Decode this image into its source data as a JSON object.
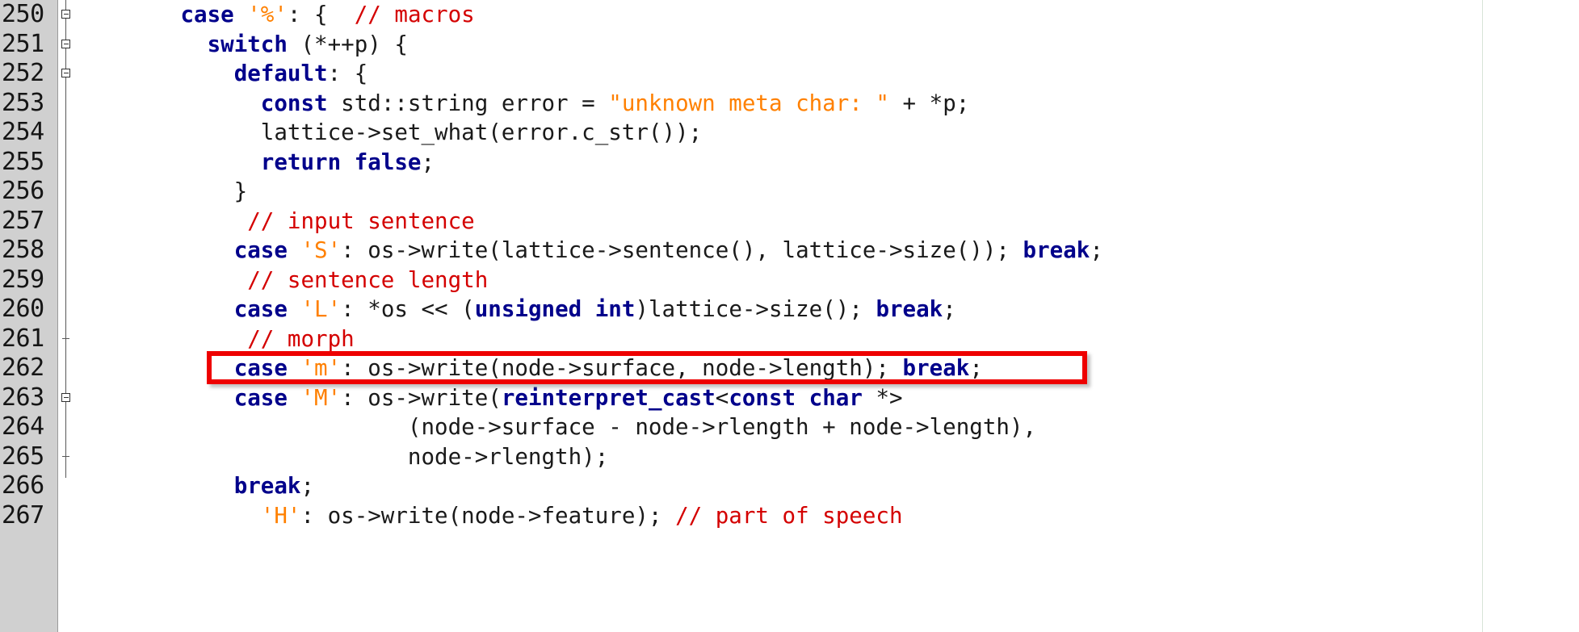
{
  "editor": {
    "language": "C++",
    "colors": {
      "background": "#ffffff",
      "gutter_background": "#d0d0d0",
      "keyword": "#00008b",
      "string": "#ff8000",
      "comment": "#d40000",
      "plain": "#1a1a1a",
      "highlight_box": "#ee0000",
      "guide_line": "#d8e4d8"
    },
    "first_visible_line": 250,
    "last_visible_line": 267
  },
  "gutter": {
    "line_numbers": [
      "250",
      "251",
      "252",
      "253",
      "254",
      "255",
      "256",
      "257",
      "258",
      "259",
      "260",
      "261",
      "262",
      "263",
      "264",
      "265",
      "266",
      "267"
    ]
  },
  "fold_markers": [
    {
      "line": "250",
      "type": "fold-box"
    },
    {
      "line": "251",
      "type": "fold-box"
    },
    {
      "line": "252",
      "type": "fold-box"
    },
    {
      "line": "261",
      "type": "fold-tick"
    },
    {
      "line": "263",
      "type": "fold-box"
    },
    {
      "line": "265",
      "type": "fold-tick"
    }
  ],
  "highlight": {
    "line": "260",
    "color": "#ee0000",
    "label": "red-annotation-box"
  },
  "code_lines": [
    {
      "number": "250",
      "text": "        case '%': {  // macros",
      "tokens": [
        {
          "t": "        ",
          "c": "pln"
        },
        {
          "t": "case",
          "c": "kw"
        },
        {
          "t": " ",
          "c": "pln"
        },
        {
          "t": "'%'",
          "c": "chr"
        },
        {
          "t": ": {  ",
          "c": "pln"
        },
        {
          "t": "// macros",
          "c": "cmt"
        }
      ]
    },
    {
      "number": "251",
      "text": "          switch (*++p) {",
      "tokens": [
        {
          "t": "          ",
          "c": "pln"
        },
        {
          "t": "switch",
          "c": "kw"
        },
        {
          "t": " (*++p) {",
          "c": "pln"
        }
      ]
    },
    {
      "number": "252",
      "text": "            default: {",
      "tokens": [
        {
          "t": "            ",
          "c": "pln"
        },
        {
          "t": "default",
          "c": "kw"
        },
        {
          "t": ": {",
          "c": "pln"
        }
      ]
    },
    {
      "number": "253",
      "text": "              const std::string error = \"unknown meta char: \" + *p;",
      "tokens": [
        {
          "t": "              ",
          "c": "pln"
        },
        {
          "t": "const",
          "c": "kw"
        },
        {
          "t": " std::string error = ",
          "c": "pln"
        },
        {
          "t": "\"unknown meta char: \"",
          "c": "str"
        },
        {
          "t": " + *p;",
          "c": "pln"
        }
      ]
    },
    {
      "number": "254",
      "text": "              lattice->set_what(error.c_str());",
      "tokens": [
        {
          "t": "              lattice->set_what(error.c_str());",
          "c": "pln"
        }
      ]
    },
    {
      "number": "255",
      "text": "              return false;",
      "tokens": [
        {
          "t": "              ",
          "c": "pln"
        },
        {
          "t": "return",
          "c": "kw"
        },
        {
          "t": " ",
          "c": "pln"
        },
        {
          "t": "false",
          "c": "kw"
        },
        {
          "t": ";",
          "c": "pln"
        }
      ]
    },
    {
      "number": "256",
      "text": "            }",
      "tokens": [
        {
          "t": "            }",
          "c": "pln"
        }
      ]
    },
    {
      "number": "257",
      "text": "             // input sentence",
      "tokens": [
        {
          "t": "             ",
          "c": "pln"
        },
        {
          "t": "// input sentence",
          "c": "cmt"
        }
      ]
    },
    {
      "number": "258",
      "text": "            case 'S': os->write(lattice->sentence(), lattice->size()); break;",
      "tokens": [
        {
          "t": "            ",
          "c": "pln"
        },
        {
          "t": "case",
          "c": "kw"
        },
        {
          "t": " ",
          "c": "pln"
        },
        {
          "t": "'S'",
          "c": "chr"
        },
        {
          "t": ": os->write(lattice->sentence(), lattice->size()); ",
          "c": "pln"
        },
        {
          "t": "break",
          "c": "kw"
        },
        {
          "t": ";",
          "c": "pln"
        }
      ]
    },
    {
      "number": "259",
      "text": "             // sentence length",
      "tokens": [
        {
          "t": "             ",
          "c": "pln"
        },
        {
          "t": "// sentence length",
          "c": "cmt"
        }
      ]
    },
    {
      "number": "260",
      "text": "            case 'L': *os << (unsigned int)lattice->size(); break;",
      "tokens": [
        {
          "t": "            ",
          "c": "pln"
        },
        {
          "t": "case",
          "c": "kw"
        },
        {
          "t": " ",
          "c": "pln"
        },
        {
          "t": "'L'",
          "c": "chr"
        },
        {
          "t": ": *os << (",
          "c": "pln"
        },
        {
          "t": "unsigned int",
          "c": "kw"
        },
        {
          "t": ")lattice->size(); ",
          "c": "pln"
        },
        {
          "t": "break",
          "c": "kw"
        },
        {
          "t": ";",
          "c": "pln"
        }
      ]
    },
    {
      "number": "261",
      "text": "             // morph",
      "tokens": [
        {
          "t": "             ",
          "c": "pln"
        },
        {
          "t": "// morph",
          "c": "cmt"
        }
      ]
    },
    {
      "number": "262",
      "text": "            case 'm': os->write(node->surface, node->length); break;",
      "tokens": [
        {
          "t": "            ",
          "c": "pln"
        },
        {
          "t": "case",
          "c": "kw"
        },
        {
          "t": " ",
          "c": "pln"
        },
        {
          "t": "'m'",
          "c": "chr"
        },
        {
          "t": ": os->write(node->surface, node->length); ",
          "c": "pln"
        },
        {
          "t": "break",
          "c": "kw"
        },
        {
          "t": ";",
          "c": "pln"
        }
      ]
    },
    {
      "number": "263",
      "text": "            case 'M': os->write(reinterpret_cast<const char *>",
      "tokens": [
        {
          "t": "            ",
          "c": "pln"
        },
        {
          "t": "case",
          "c": "kw"
        },
        {
          "t": " ",
          "c": "pln"
        },
        {
          "t": "'M'",
          "c": "chr"
        },
        {
          "t": ": os->write(",
          "c": "pln"
        },
        {
          "t": "reinterpret_cast",
          "c": "kw"
        },
        {
          "t": "<",
          "c": "pln"
        },
        {
          "t": "const char",
          "c": "kw"
        },
        {
          "t": " *>",
          "c": "pln"
        }
      ]
    },
    {
      "number": "264",
      "text": "                         (node->surface - node->rlength + node->length),",
      "tokens": [
        {
          "t": "                         (node->surface - node->rlength + node->length),",
          "c": "pln"
        }
      ]
    },
    {
      "number": "265",
      "text": "                         node->rlength);",
      "tokens": [
        {
          "t": "                         node->rlength);",
          "c": "pln"
        }
      ]
    },
    {
      "number": "266",
      "text": "            break;",
      "tokens": [
        {
          "t": "            ",
          "c": "pln"
        },
        {
          "t": "break",
          "c": "kw"
        },
        {
          "t": ";",
          "c": "pln"
        }
      ]
    },
    {
      "number": "267",
      "text": "              'H': os->write(node->feature); // part of speech",
      "tokens": [
        {
          "t": "              ",
          "c": "pln"
        },
        {
          "t": "'H'",
          "c": "chr"
        },
        {
          "t": ": os->write(node->feature); ",
          "c": "pln"
        },
        {
          "t": "// part of speech",
          "c": "cmt"
        }
      ]
    }
  ]
}
